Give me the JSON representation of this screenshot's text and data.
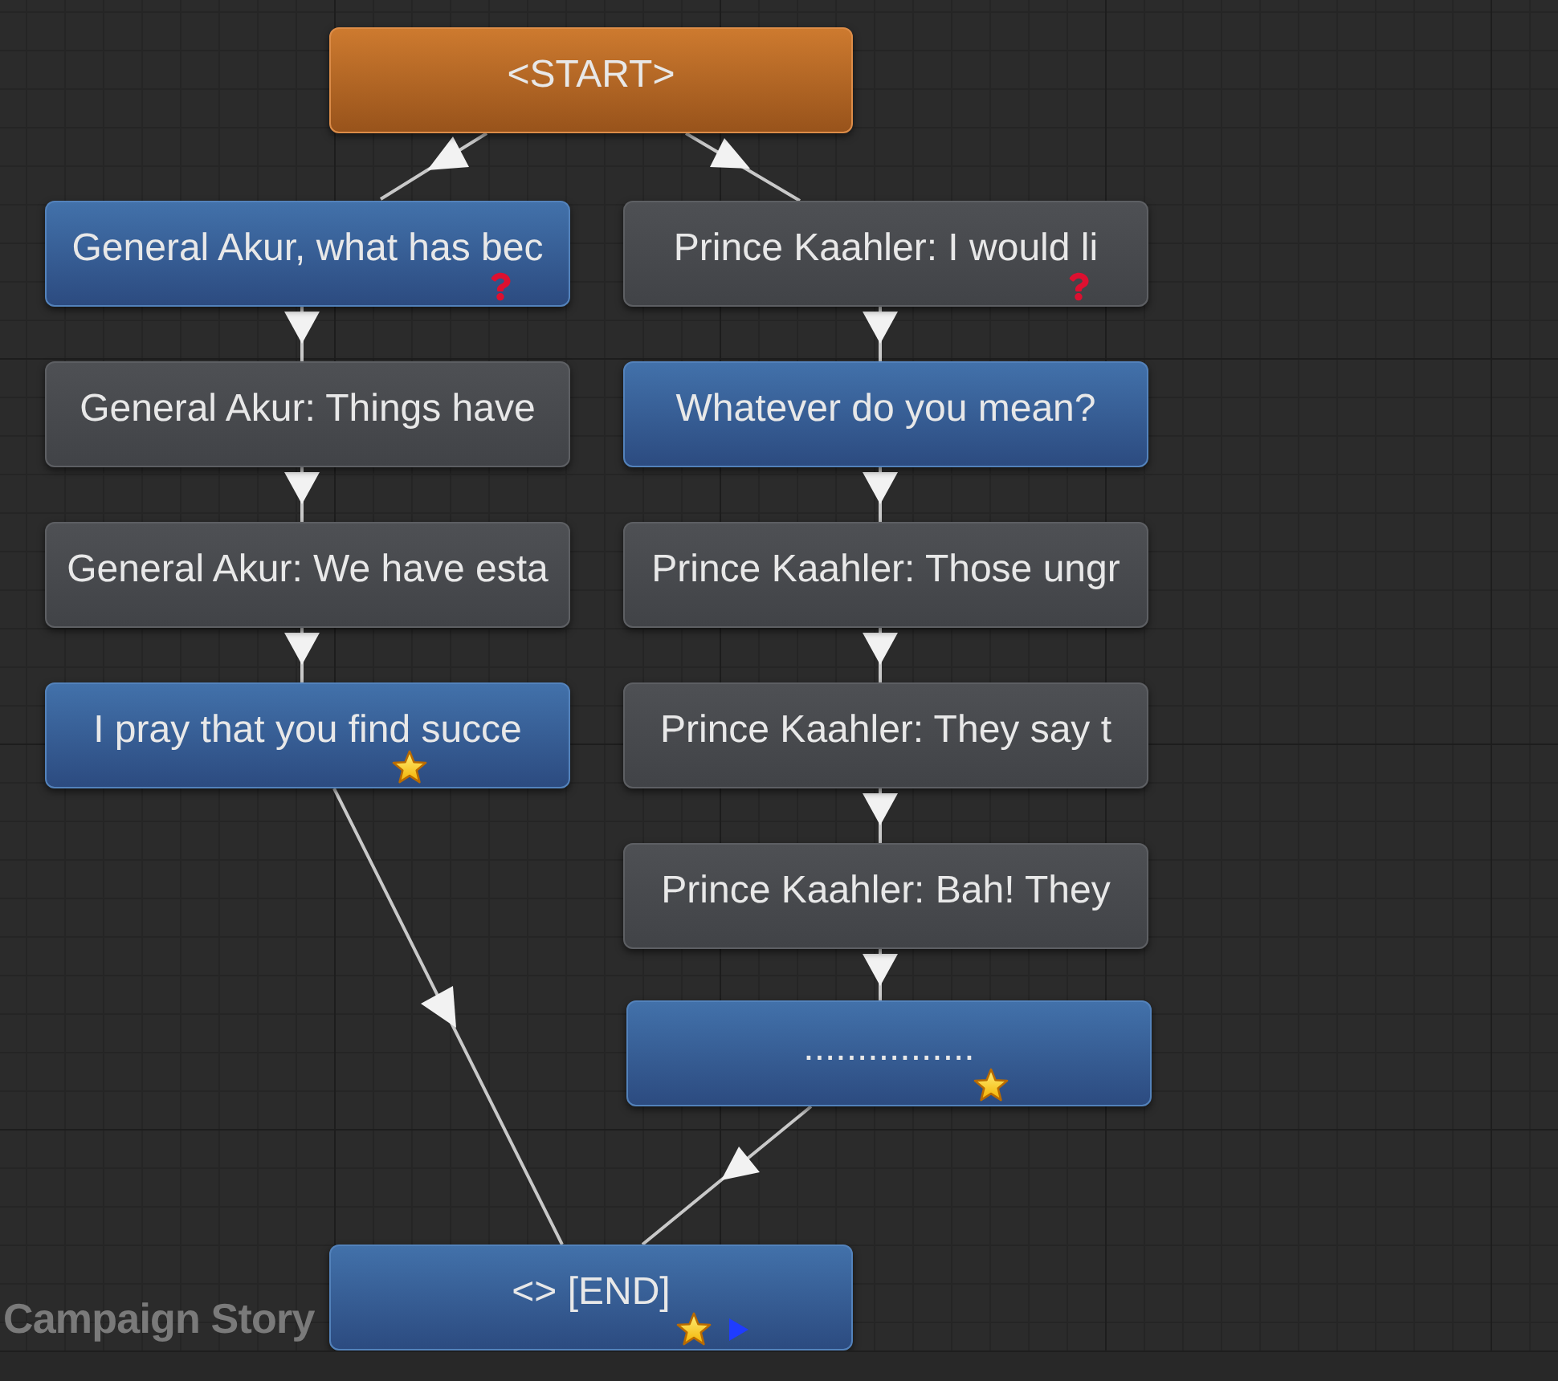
{
  "canvas": {
    "title": "Campaign Story"
  },
  "start_node": {
    "kind": "start",
    "label": "<START>"
  },
  "branches": [
    {
      "nodes": [
        {
          "kind": "player",
          "label": "General Akur, what has bec",
          "question": true,
          "star": false
        },
        {
          "kind": "npc",
          "label": "General Akur: Things have",
          "question": false,
          "star": false
        },
        {
          "kind": "npc",
          "label": "General Akur: We have esta",
          "question": false,
          "star": false
        },
        {
          "kind": "player",
          "label": "I pray that you find succe",
          "question": false,
          "star": true
        }
      ]
    },
    {
      "nodes": [
        {
          "kind": "npc",
          "label": "Prince Kaahler: I would li",
          "question": true,
          "star": false
        },
        {
          "kind": "player",
          "label": "Whatever do you mean?",
          "question": false,
          "star": false
        },
        {
          "kind": "npc",
          "label": "Prince Kaahler: Those ungr",
          "question": false,
          "star": false
        },
        {
          "kind": "npc",
          "label": "Prince Kaahler: They say t",
          "question": false,
          "star": false
        },
        {
          "kind": "npc",
          "label": "Prince Kaahler: Bah! They",
          "question": false,
          "star": false
        },
        {
          "kind": "player",
          "label": "................",
          "question": false,
          "star": true
        }
      ]
    }
  ],
  "end_node": {
    "kind": "end",
    "label": "<> [END]",
    "star": true,
    "play": true
  }
}
